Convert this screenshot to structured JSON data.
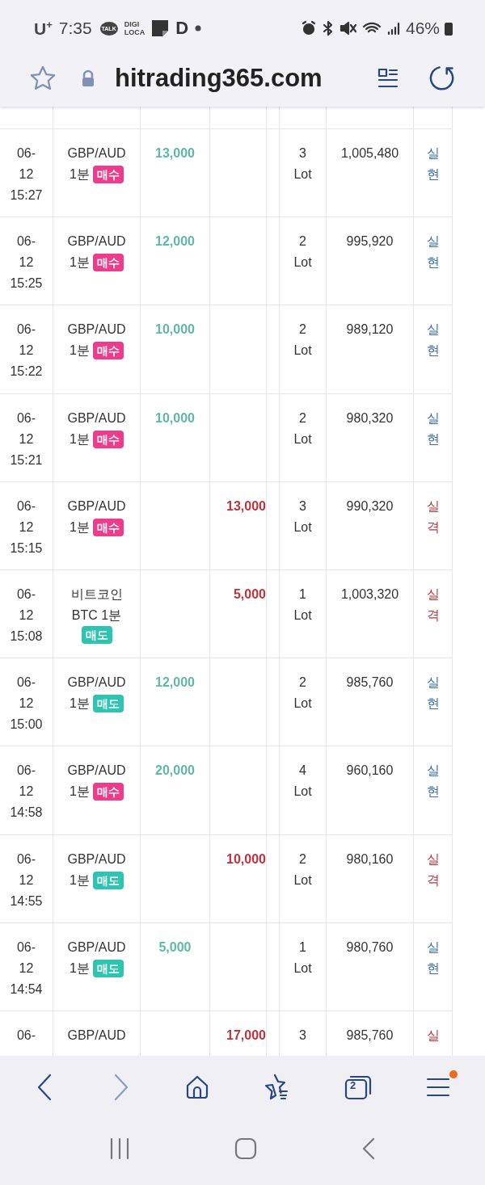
{
  "status_bar": {
    "carrier": "U$^{+}$",
    "time": "7:35",
    "notifications": [
      {
        "kind": "talk",
        "text": "TALK"
      },
      {
        "kind": "digiloca",
        "text": "DIGI LOCA"
      },
      {
        "kind": "note"
      },
      {
        "kind": "letter",
        "text": "D"
      },
      {
        "kind": "dot"
      }
    ],
    "battery": "46%"
  },
  "address_bar": {
    "url": "hitrading365.com"
  },
  "trades": [
    {
      "date_lines": [
        "06-",
        "12",
        "15:27"
      ],
      "instrument_lines": [
        "GBP/AUD",
        "1분"
      ],
      "side": {
        "label": "매수",
        "kind": "buy"
      },
      "profit": "13,000",
      "lots": [
        "3",
        "Lot"
      ],
      "balance": "1,005,480",
      "result": {
        "text": "실현",
        "kind": "realized"
      }
    },
    {
      "date_lines": [
        "06-",
        "12",
        "15:25"
      ],
      "instrument_lines": [
        "GBP/AUD",
        "1분"
      ],
      "side": {
        "label": "매수",
        "kind": "buy"
      },
      "profit": "12,000",
      "lots": [
        "2",
        "Lot"
      ],
      "balance": "995,920",
      "result": {
        "text": "실현",
        "kind": "realized"
      }
    },
    {
      "date_lines": [
        "06-",
        "12",
        "15:22"
      ],
      "instrument_lines": [
        "GBP/AUD",
        "1분"
      ],
      "side": {
        "label": "매수",
        "kind": "buy"
      },
      "profit": "10,000",
      "lots": [
        "2",
        "Lot"
      ],
      "balance": "989,120",
      "result": {
        "text": "실현",
        "kind": "realized"
      }
    },
    {
      "date_lines": [
        "06-",
        "12",
        "15:21"
      ],
      "instrument_lines": [
        "GBP/AUD",
        "1분"
      ],
      "side": {
        "label": "매수",
        "kind": "buy"
      },
      "profit": "10,000",
      "lots": [
        "2",
        "Lot"
      ],
      "balance": "980,320",
      "result": {
        "text": "실현",
        "kind": "realized"
      }
    },
    {
      "date_lines": [
        "06-",
        "12",
        "15:15"
      ],
      "instrument_lines": [
        "GBP/AUD",
        "1분"
      ],
      "side": {
        "label": "매수",
        "kind": "buy"
      },
      "loss": "13,000",
      "lots": [
        "3",
        "Lot"
      ],
      "balance": "990,320",
      "result": {
        "text": "실격",
        "kind": "failed"
      }
    },
    {
      "date_lines": [
        "06-",
        "12",
        "15:08"
      ],
      "instrument_lines": [
        "비트코인",
        "BTC 1분"
      ],
      "side": {
        "label": "매도",
        "kind": "sell"
      },
      "loss": "5,000",
      "lots": [
        "1",
        "Lot"
      ],
      "balance": "1,003,320",
      "result": {
        "text": "실격",
        "kind": "failed"
      }
    },
    {
      "date_lines": [
        "06-",
        "12",
        "15:00"
      ],
      "instrument_lines": [
        "GBP/AUD",
        "1분"
      ],
      "side": {
        "label": "매도",
        "kind": "sell"
      },
      "profit": "12,000",
      "lots": [
        "2",
        "Lot"
      ],
      "balance": "985,760",
      "result": {
        "text": "실현",
        "kind": "realized"
      }
    },
    {
      "date_lines": [
        "06-",
        "12",
        "14:58"
      ],
      "instrument_lines": [
        "GBP/AUD",
        "1분"
      ],
      "side": {
        "label": "매수",
        "kind": "buy"
      },
      "profit": "20,000",
      "lots": [
        "4",
        "Lot"
      ],
      "balance": "960,160",
      "result": {
        "text": "실현",
        "kind": "realized"
      }
    },
    {
      "date_lines": [
        "06-",
        "12",
        "14:55"
      ],
      "instrument_lines": [
        "GBP/AUD",
        "1분"
      ],
      "side": {
        "label": "매도",
        "kind": "sell"
      },
      "loss": "10,000",
      "lots": [
        "2",
        "Lot"
      ],
      "balance": "980,160",
      "result": {
        "text": "실격",
        "kind": "failed"
      }
    },
    {
      "date_lines": [
        "06-",
        "12",
        "14:54"
      ],
      "instrument_lines": [
        "GBP/AUD",
        "1분"
      ],
      "side": {
        "label": "매도",
        "kind": "sell"
      },
      "profit": "5,000",
      "lots": [
        "1",
        "Lot"
      ],
      "balance": "980,760",
      "result": {
        "text": "실현",
        "kind": "realized"
      }
    },
    {
      "date_lines": [
        "06-"
      ],
      "instrument_lines": [
        "GBP/AUD"
      ],
      "loss": "17,000",
      "lots": [
        "3"
      ],
      "balance": "985,760",
      "result": {
        "text": "실",
        "kind": "failed"
      }
    }
  ],
  "toolbar": {
    "tab_count": "2",
    "menu_badge": true
  }
}
